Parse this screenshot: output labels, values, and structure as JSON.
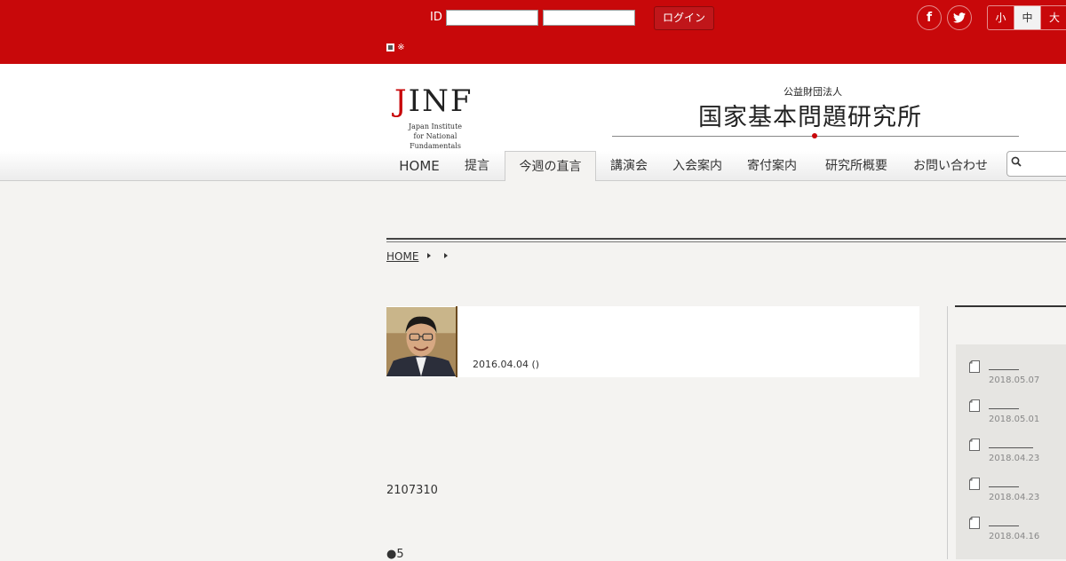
{
  "topbar": {
    "id_label": "ID",
    "login_button": "ログイン",
    "remember_mark": "※",
    "social_facebook": "f",
    "social_twitter": "t",
    "font_sizes": [
      "小",
      "中",
      "大"
    ],
    "active_font_size": "中"
  },
  "header": {
    "logo_j": "J",
    "logo_rest": "INF",
    "logo_sub_line1": "Japan Institute",
    "logo_sub_line2": "for National Fundamentals",
    "org_small": "公益財団法人",
    "org_name": "国家基本問題研究所"
  },
  "nav": {
    "items": [
      "HOME",
      "提言",
      "今週の直言",
      "講演会",
      "入会案内",
      "寄付案内",
      "研究所概要",
      "お問い合わせ"
    ],
    "active": "今週の直言"
  },
  "breadcrumb": {
    "home": "HOME"
  },
  "article": {
    "date": "2016.04.04 ()",
    "body_line1": "2107310",
    "body_line2": "●5"
  },
  "sidebar": {
    "items": [
      {
        "date": "2018.05.07"
      },
      {
        "date": "2018.05.01"
      },
      {
        "date": "2018.04.23"
      },
      {
        "date": "2018.04.23"
      },
      {
        "date": "2018.04.16"
      }
    ]
  },
  "colors": {
    "brand_red": "#c8080a",
    "page_bg": "#f4f3f1"
  }
}
